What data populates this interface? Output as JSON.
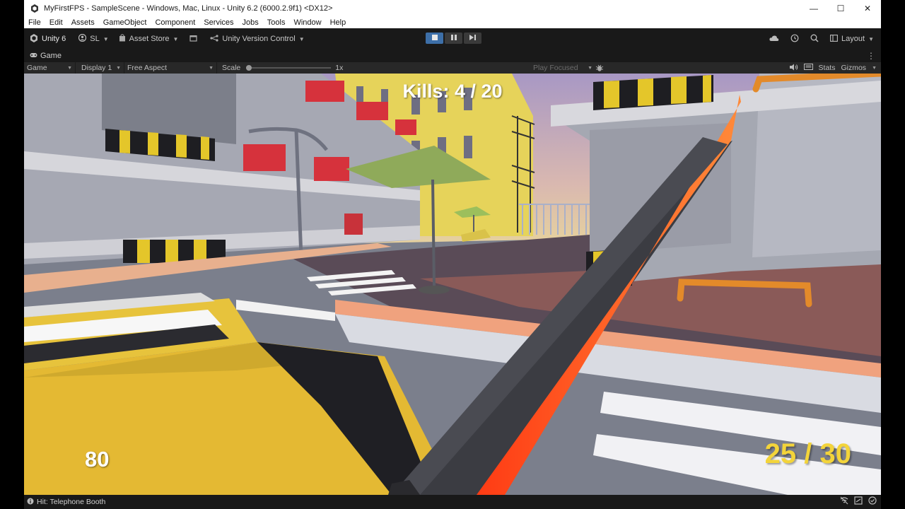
{
  "window": {
    "title": "MyFirstFPS - SampleScene - Windows, Mac, Linux - Unity 6.2 (6000.2.9f1) <DX12>",
    "minimize": "—",
    "maximize": "☐",
    "close": "✕"
  },
  "menu": [
    "File",
    "Edit",
    "Assets",
    "GameObject",
    "Component",
    "Services",
    "Jobs",
    "Tools",
    "Window",
    "Help"
  ],
  "toolbar": {
    "unity_label": "Unity 6",
    "account_label": "SL",
    "asset_store_label": "Asset Store",
    "version_control_label": "Unity Version Control",
    "layout_label": "Layout"
  },
  "game_tab": {
    "tab_label": "Game",
    "view_select": "Game",
    "display_select": "Display 1",
    "aspect_select": "Free Aspect",
    "scale_label": "Scale",
    "scale_value": "1x",
    "play_mode_select": "Play Focused",
    "stats_label": "Stats",
    "gizmos_label": "Gizmos"
  },
  "hud": {
    "kills": "Kills: 4 / 20",
    "health": "80",
    "ammo": "25 / 30"
  },
  "status": {
    "message": "Hit: Telephone Booth"
  },
  "colors": {
    "play_active": "#3d6fa8",
    "ammo_text": "#f3d43a",
    "blade_glow": "#ff5a1e"
  }
}
